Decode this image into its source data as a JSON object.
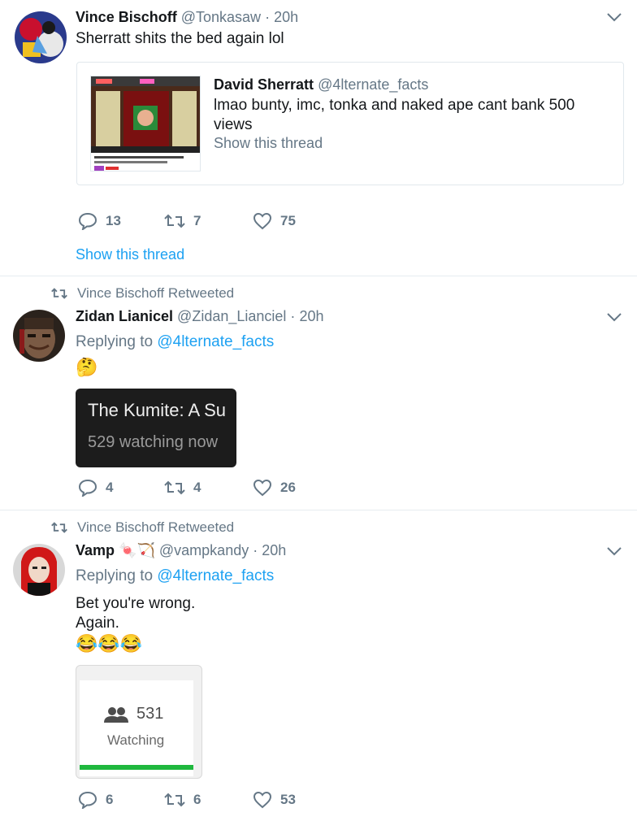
{
  "tweets": [
    {
      "name": "Vince Bischoff",
      "handle": "@Tonkasaw",
      "dot": "·",
      "time": "20h",
      "text": "Sherratt shits the bed again lol",
      "quote": {
        "name": "David Sherratt",
        "handle": "@4lternate_facts",
        "text": "lmao bunty, imc, tonka and naked ape cant bank 500 views",
        "show_thread": "Show this thread"
      },
      "replies": "13",
      "retweets": "7",
      "likes": "75",
      "show_thread": "Show this thread"
    },
    {
      "retweeted_by": "Vince Bischoff Retweeted",
      "name": "Zidan Lianicel",
      "handle": "@Zidan_Lianciel",
      "dot": "·",
      "time": "20h",
      "replying_prefix": "Replying to",
      "replying_handle": "@4lternate_facts",
      "emoji": "🤔",
      "media": {
        "title": "The Kumite: A Su",
        "subtitle": "529 watching now"
      },
      "replies": "4",
      "retweets": "4",
      "likes": "26"
    },
    {
      "retweeted_by": "Vince Bischoff Retweeted",
      "name": "Vamp",
      "name_emoji": "🍬🏹",
      "handle": "@vampkandy",
      "dot": "·",
      "time": "20h",
      "replying_prefix": "Replying to",
      "replying_handle": "@4lternate_facts",
      "text_line1": "Bet you're wrong.",
      "text_line2": "Again.",
      "emoji": "😂😂😂",
      "media": {
        "count": "531",
        "label": "Watching"
      },
      "replies": "6",
      "retweets": "6",
      "likes": "53"
    }
  ],
  "colors": {
    "link": "#1da1f2",
    "muted": "#657786",
    "text": "#14171a",
    "divider": "#e6ecf0",
    "watch_bar": "#1fb83e"
  },
  "icons": [
    "reply-icon",
    "retweet-icon",
    "like-icon",
    "chevron-down-icon",
    "people-icon"
  ]
}
